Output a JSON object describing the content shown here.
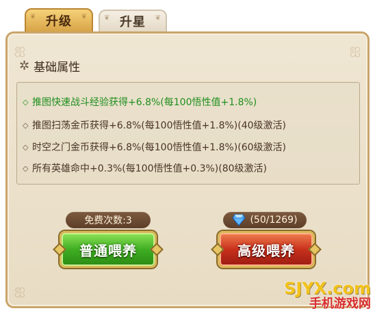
{
  "tabs": [
    {
      "label": "升级",
      "active": true
    },
    {
      "label": "升星",
      "active": false
    }
  ],
  "section": {
    "title": "基础属性",
    "icon": "star-icon"
  },
  "attributes": [
    {
      "text": "推图快速战斗经验获得+6.8%(每100悟性值+1.8%)",
      "active": true
    },
    {
      "text": "推图扫荡金币获得+6.8%(每100悟性值+1.8%)(40级激活)",
      "active": false
    },
    {
      "text": "时空之门金币获得+6.8%(每100悟性值+1.8%)(60级激活)",
      "active": false
    },
    {
      "text": "所有英雄命中+0.3%(每100悟性值+0.3%)(80级激活)",
      "active": false
    }
  ],
  "feed": {
    "free_count_label": "免费次数:3",
    "gem_count": "(50/1269)",
    "normal_button": "普通喂养",
    "advanced_button": "高级喂养"
  },
  "colors": {
    "active_attribute": "#1f8f1f",
    "normal_button": "#3fae22",
    "advanced_button": "#c8301c"
  },
  "watermark": {
    "site": "SJYX.com",
    "name": "手机游戏网"
  }
}
